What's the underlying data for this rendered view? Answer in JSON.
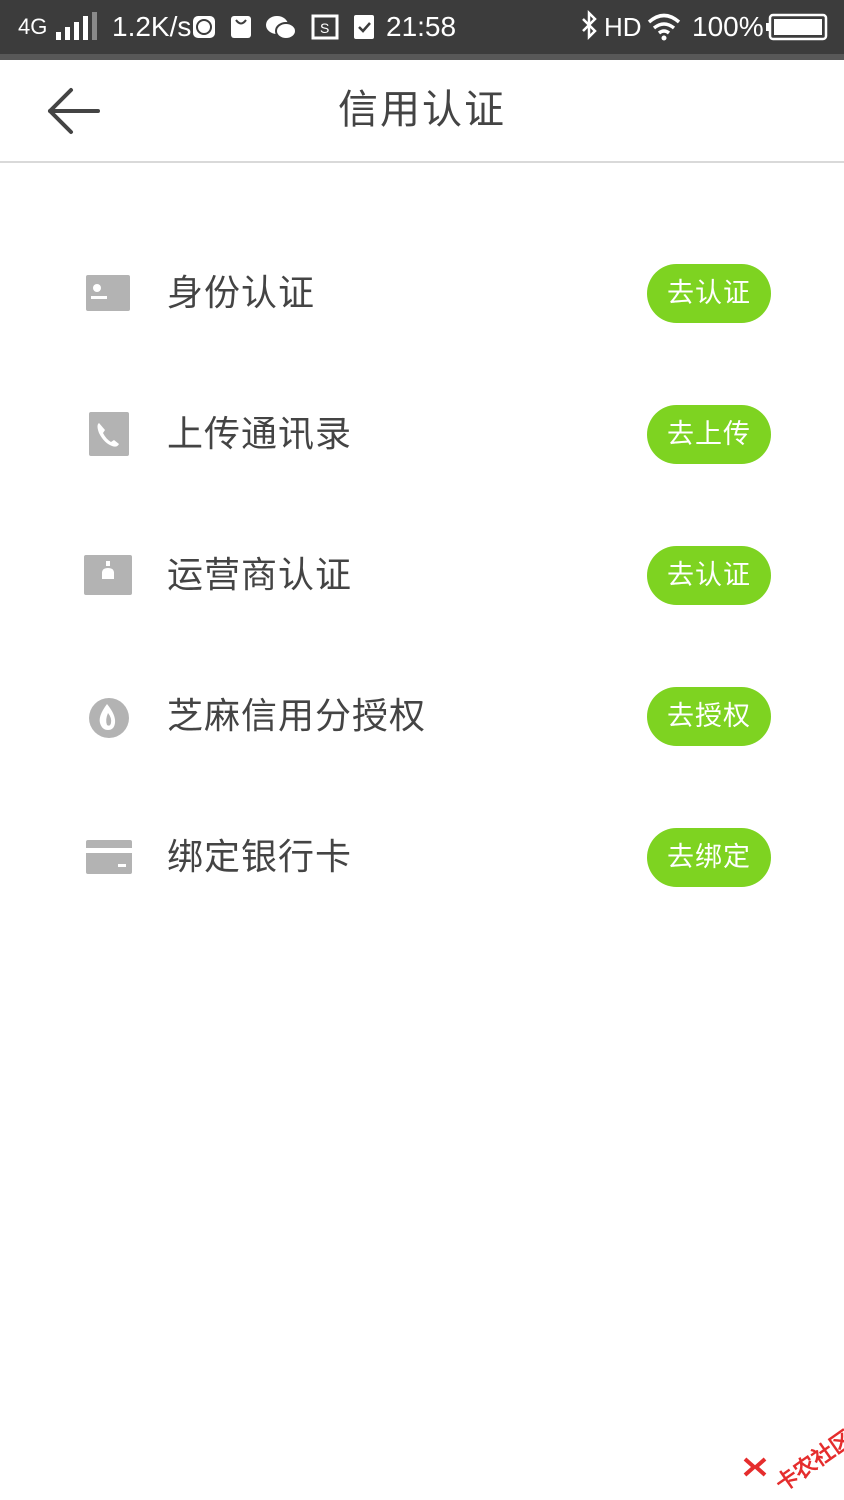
{
  "status_bar": {
    "network": "4G",
    "speed": "1.2K/s",
    "time": "21:58",
    "hd": "HD",
    "battery": "100%"
  },
  "header": {
    "title": "信用认证",
    "back_icon": "arrow-left-icon"
  },
  "items": [
    {
      "label": "身份认证",
      "button": "去认证",
      "icon": "id-card-icon"
    },
    {
      "label": "上传通讯录",
      "button": "去上传",
      "icon": "phone-book-icon"
    },
    {
      "label": "运营商认证",
      "button": "去认证",
      "icon": "carrier-icon"
    },
    {
      "label": "芝麻信用分授权",
      "button": "去授权",
      "icon": "sesame-drop-icon"
    },
    {
      "label": "绑定银行卡",
      "button": "去绑定",
      "icon": "bank-card-icon"
    }
  ],
  "watermark": {
    "text": "卡农社区",
    "icon": "kanong-logo-icon"
  },
  "colors": {
    "accent": "#7ed321",
    "status_bar": "#3c3c3c",
    "text": "#444444",
    "icon": "#b3b3b3",
    "divider": "#d9d9d9"
  }
}
